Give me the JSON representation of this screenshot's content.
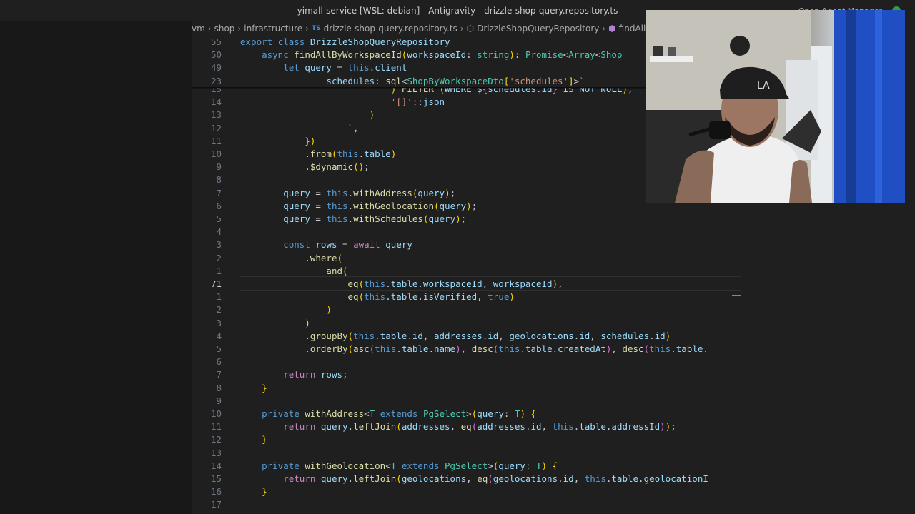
{
  "window": {
    "title": "yimall-service [WSL: debian] - Antigravity - drizzle-shop-query.repository.ts",
    "right_label": "Open Agent Manager"
  },
  "breadcrumb": {
    "items": [
      "vm",
      "shop",
      "infrastructure",
      "drizzle-shop-query.repository.ts",
      "DrizzleShopQueryRepository",
      "findAllByW"
    ],
    "ts_badge": "TS"
  },
  "editor": {
    "sticky": [
      {
        "num": "55",
        "text": "export class DrizzleShopQueryRepository"
      },
      {
        "num": "50",
        "text": "    async findAllByWorkspaceId(workspaceId: string): Promise<Array<Shop"
      },
      {
        "num": "49",
        "text": "        let query = this.client"
      },
      {
        "num": "23",
        "text": "                schedules: sql<ShopByWorkspaceDto['schedules']>`"
      }
    ],
    "lines": [
      {
        "num": "15",
        "text": "                            ) FILTER (WHERE ${schedules.id} IS NOT NULL),"
      },
      {
        "num": "14",
        "text": "                            '[]'::json"
      },
      {
        "num": "13",
        "text": "                        )"
      },
      {
        "num": "12",
        "text": "                    `,"
      },
      {
        "num": "11",
        "text": "            })"
      },
      {
        "num": "10",
        "text": "            .from(this.table)"
      },
      {
        "num": "9",
        "text": "            .$dynamic();"
      },
      {
        "num": "8",
        "text": ""
      },
      {
        "num": "7",
        "text": "        query = this.withAddress(query);"
      },
      {
        "num": "6",
        "text": "        query = this.withGeolocation(query);"
      },
      {
        "num": "5",
        "text": "        query = this.withSchedules(query);"
      },
      {
        "num": "4",
        "text": ""
      },
      {
        "num": "3",
        "text": "        const rows = await query"
      },
      {
        "num": "2",
        "text": "            .where("
      },
      {
        "num": "1",
        "text": "                and("
      },
      {
        "num": "71",
        "text": "                    eq(this.table.workspaceId, workspaceId),"
      },
      {
        "num": "1",
        "text": "                    eq(this.table.isVerified, true)"
      },
      {
        "num": "2",
        "text": "                )"
      },
      {
        "num": "3",
        "text": "            )"
      },
      {
        "num": "4",
        "text": "            .groupBy(this.table.id, addresses.id, geolocations.id, schedules.id)"
      },
      {
        "num": "5",
        "text": "            .orderBy(asc(this.table.name), desc(this.table.createdAt), desc(this.table."
      },
      {
        "num": "6",
        "text": ""
      },
      {
        "num": "7",
        "text": "        return rows;"
      },
      {
        "num": "8",
        "text": "    }"
      },
      {
        "num": "9",
        "text": ""
      },
      {
        "num": "10",
        "text": "    private withAddress<T extends PgSelect>(query: T) {"
      },
      {
        "num": "11",
        "text": "        return query.leftJoin(addresses, eq(addresses.id, this.table.addressId));"
      },
      {
        "num": "12",
        "text": "    }"
      },
      {
        "num": "13",
        "text": ""
      },
      {
        "num": "14",
        "text": "    private withGeolocation<T extends PgSelect>(query: T) {"
      },
      {
        "num": "15",
        "text": "        return query.leftJoin(geolocations, eq(geolocations.id, this.table.geolocationI"
      },
      {
        "num": "16",
        "text": "    }"
      },
      {
        "num": "17",
        "text": ""
      }
    ],
    "current_line": "71"
  },
  "colors": {
    "keyword": "#569cd6",
    "control": "#c586c0",
    "function": "#dcdcaa",
    "type": "#4ec9b0",
    "variable": "#9cdcfe",
    "string": "#ce9178"
  }
}
